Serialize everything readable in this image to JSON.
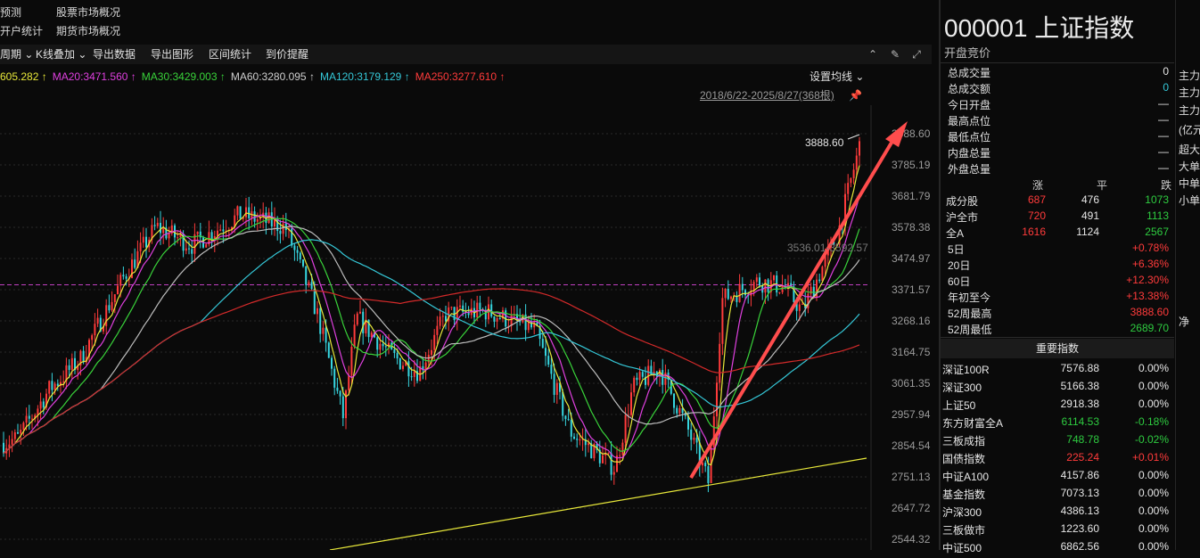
{
  "top_menu": {
    "row1": [
      "预测",
      "股票市场概况"
    ],
    "row2": [
      "开户统计",
      "期货市场概况"
    ]
  },
  "toolbar": {
    "items": [
      "周期",
      "K线叠加",
      "导出数据",
      "导出图形",
      "区间统计",
      "到价提醒"
    ],
    "icons": [
      "circle-chevron-icon",
      "brush-icon",
      "expand-icon"
    ]
  },
  "ma_row": [
    {
      "label": "605.282 ↑",
      "color": "#e8e83a"
    },
    {
      "label": "MA20:3471.560 ↑",
      "color": "#e040e0"
    },
    {
      "label": "MA30:3429.003 ↑",
      "color": "#39d33a"
    },
    {
      "label": "MA60:3280.095 ↑",
      "color": "#cfcfcf"
    },
    {
      "label": "MA120:3179.129 ↑",
      "color": "#35c8d8"
    },
    {
      "label": "MA250:3277.610 ↑",
      "color": "#ff3b3b"
    }
  ],
  "settings_label": "设置均线",
  "date_range": "2018/6/22-2025/8/27(368根)",
  "chart_data": {
    "type": "candlestick",
    "y_ticks": [
      "3888.60",
      "3785.19",
      "3681.79",
      "3578.38",
      "3474.97",
      "3371.57",
      "3268.16",
      "3164.75",
      "3061.35",
      "2957.94",
      "2854.54",
      "2751.13",
      "2647.72",
      "2544.32"
    ],
    "ylim": [
      2544.32,
      3888.6
    ],
    "high_label": "3888.60",
    "range_label": "3536.01-3592.57",
    "ref_line": 3388
  },
  "stock": {
    "code_name": "000001 上证指数",
    "subtitle": "开盘竞价",
    "stats": [
      {
        "label": "总成交量",
        "value": "0",
        "cls": "white"
      },
      {
        "label": "总成交额",
        "value": "0",
        "cls": "cyan"
      },
      {
        "label": "今日开盘",
        "value": "—",
        "cls": "white"
      },
      {
        "label": "最高点位",
        "value": "—",
        "cls": "white"
      },
      {
        "label": "最低点位",
        "value": "—",
        "cls": "white"
      },
      {
        "label": "内盘总量",
        "value": "—",
        "cls": "white"
      },
      {
        "label": "外盘总量",
        "value": "—",
        "cls": "white"
      }
    ],
    "breadth_headers": [
      "涨",
      "平",
      "跌"
    ],
    "breadth": [
      {
        "label": "成分股",
        "up": "687",
        "flat": "476",
        "down": "1073"
      },
      {
        "label": "沪全市",
        "up": "720",
        "flat": "491",
        "down": "1113"
      },
      {
        "label": "全A",
        "up": "1616",
        "flat": "1124",
        "down": "2567"
      }
    ],
    "periods": [
      {
        "label": "5日",
        "value": "+0.78%",
        "cls": "red"
      },
      {
        "label": "20日",
        "value": "+6.36%",
        "cls": "red"
      },
      {
        "label": "60日",
        "value": "+12.30%",
        "cls": "red"
      },
      {
        "label": "年初至今",
        "value": "+13.38%",
        "cls": "red"
      },
      {
        "label": "52周最高",
        "value": "3888.60",
        "cls": "red"
      },
      {
        "label": "52周最低",
        "value": "2689.70",
        "cls": "green"
      }
    ],
    "index_header": "重要指数",
    "indices": [
      {
        "name": "深证100R",
        "value": "7576.88",
        "change": "0.00%",
        "cls": "white"
      },
      {
        "name": "深证300",
        "value": "5166.38",
        "change": "0.00%",
        "cls": "white"
      },
      {
        "name": "上证50",
        "value": "2918.38",
        "change": "0.00%",
        "cls": "white"
      },
      {
        "name": "东方财富全A",
        "value": "6114.53",
        "change": "-0.18%",
        "cls": "green"
      },
      {
        "name": "三板成指",
        "value": "748.78",
        "change": "-0.02%",
        "cls": "green"
      },
      {
        "name": "国债指数",
        "value": "225.24",
        "change": "+0.01%",
        "cls": "red"
      },
      {
        "name": "中证A100",
        "value": "4157.86",
        "change": "0.00%",
        "cls": "white"
      },
      {
        "name": "基金指数",
        "value": "7073.13",
        "change": "0.00%",
        "cls": "white"
      },
      {
        "name": "沪深300",
        "value": "4386.13",
        "change": "0.00%",
        "cls": "white"
      },
      {
        "name": "三板做市",
        "value": "1223.60",
        "change": "0.00%",
        "cls": "white"
      },
      {
        "name": "中证500",
        "value": "6862.56",
        "change": "0.00%",
        "cls": "white"
      }
    ]
  },
  "far_column": [
    "主力",
    "主力",
    "主力",
    "(亿元",
    "超大",
    "大单",
    "中单",
    "小单",
    "净"
  ]
}
